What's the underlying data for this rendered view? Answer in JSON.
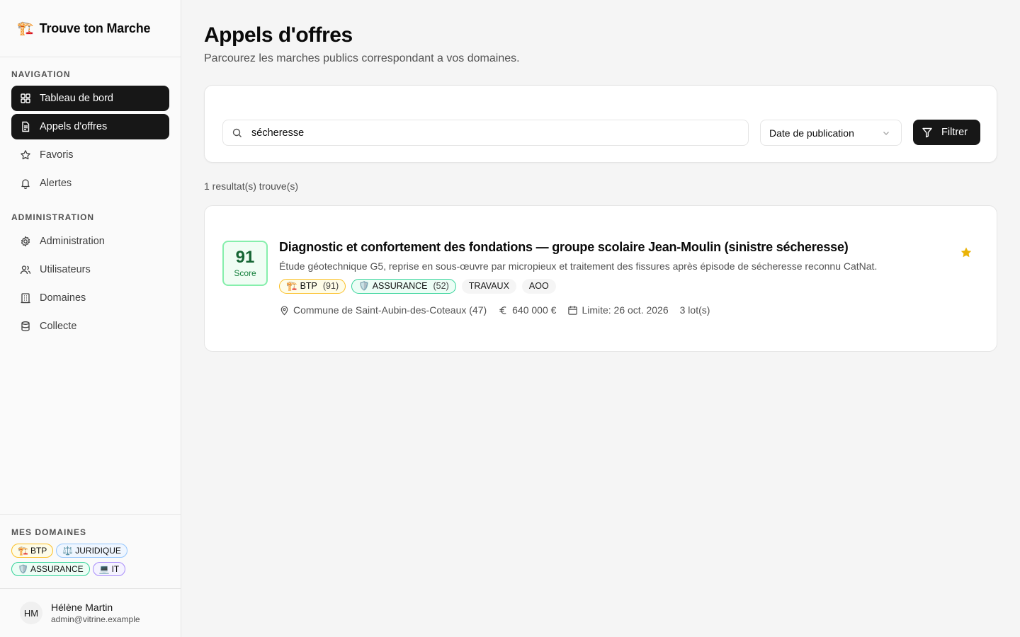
{
  "brand": {
    "icon": "🏗️",
    "name": "Trouve ton Marche"
  },
  "nav": {
    "section_title": "NAVIGATION",
    "items": [
      {
        "label": "Tableau de bord",
        "icon": "dashboard-icon",
        "active": true
      },
      {
        "label": "Appels d'offres",
        "icon": "document-icon",
        "active": true
      },
      {
        "label": "Favoris",
        "icon": "star-icon",
        "active": false
      },
      {
        "label": "Alertes",
        "icon": "bell-icon",
        "active": false
      }
    ]
  },
  "admin": {
    "section_title": "ADMINISTRATION",
    "items": [
      {
        "label": "Administration",
        "icon": "gear-icon"
      },
      {
        "label": "Utilisateurs",
        "icon": "users-icon"
      },
      {
        "label": "Domaines",
        "icon": "building-icon"
      },
      {
        "label": "Collecte",
        "icon": "database-icon"
      }
    ]
  },
  "my_domains": {
    "title": "MES DOMAINES",
    "chips": [
      {
        "emoji": "🏗️",
        "label": "BTP"
      },
      {
        "emoji": "⚖️",
        "label": "JURIDIQUE"
      },
      {
        "emoji": "🛡️",
        "label": "ASSURANCE"
      },
      {
        "emoji": "💻",
        "label": "IT"
      }
    ]
  },
  "user": {
    "initials": "HM",
    "name": "Hélène Martin",
    "email": "admin@vitrine.example"
  },
  "page": {
    "title": "Appels d'offres",
    "subtitle": "Parcourez les marches publics correspondant a vos domaines."
  },
  "filters": {
    "search_value": "sécheresse",
    "sort_label": "Date de publication",
    "filter_button": "Filtrer"
  },
  "result_count": "1 resultat(s) trouve(s)",
  "results": [
    {
      "score": "91",
      "score_label": "Score",
      "title": "Diagnostic et confortement des fondations — groupe scolaire Jean-Moulin (sinistre sécheresse)",
      "description": "Étude géotechnique G5, reprise en sous-œuvre par micropieux et traitement des fissures après épisode de sécheresse reconnu CatNat.",
      "tags": [
        {
          "emoji": "🏗️",
          "label": "BTP",
          "count": "(91)"
        },
        {
          "emoji": "🛡️",
          "label": "ASSURANCE",
          "count": "(52)"
        },
        {
          "label": "TRAVAUX"
        },
        {
          "label": "AOO"
        }
      ],
      "location": "Commune de Saint-Aubin-des-Coteaux (47)",
      "amount": "640 000 €",
      "deadline": "Limite: 26 oct. 2026",
      "lots": "3 lot(s)",
      "favorite": true
    }
  ],
  "colors": {
    "accent": "#171717",
    "score_green": "#166534",
    "star": "#eab308"
  }
}
